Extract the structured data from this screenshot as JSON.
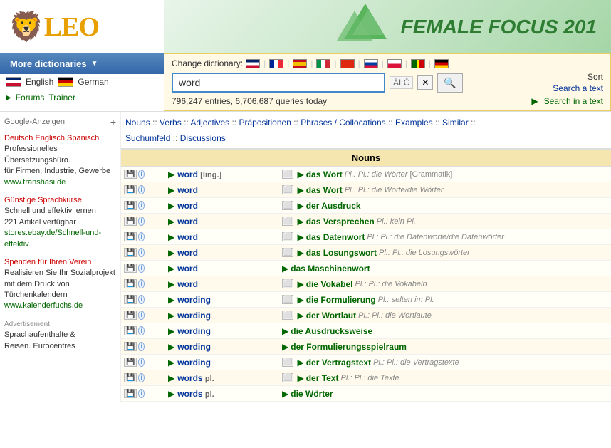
{
  "header": {
    "logo_text": "LEO",
    "banner_text": "FEMALE FOCUS 201",
    "more_dict_label": "More dictionaries",
    "lang1": "English",
    "lang2": "German",
    "forums_label": "Forums",
    "trainer_label": "Trainer"
  },
  "search": {
    "change_dict_label": "Change dictionary:",
    "input_value": "word",
    "options_label": "ÄLČ",
    "stats_text": "796,247 entries, 6,706,687 queries today",
    "search_in_text_label": "Search in a text",
    "sort_label": "Sort",
    "search_a_text_label": "Search a text"
  },
  "nav": {
    "items": [
      {
        "label": "Nouns",
        "sep": " :: "
      },
      {
        "label": "Verbs",
        "sep": " :: "
      },
      {
        "label": "Adjectives",
        "sep": " :: "
      },
      {
        "label": "Präpositionen",
        "sep": " :: "
      },
      {
        "label": "Phrases / Collocations",
        "sep": " :: "
      },
      {
        "label": "Examples",
        "sep": " :: "
      },
      {
        "label": "Similar",
        "sep": " :: "
      },
      {
        "label": "Suchumfeld",
        "sep": " :: "
      },
      {
        "label": "Discussions",
        "sep": ""
      }
    ]
  },
  "section_label": "Nouns",
  "results": [
    {
      "en": "word",
      "en_tag": "[ling.]",
      "de": "das Wort",
      "de_pl": "Pl.: die Wörter",
      "de_extra": "[Grammatik]",
      "has_copy": true
    },
    {
      "en": "word",
      "en_tag": "",
      "de": "das Wort",
      "de_pl": "Pl.: die Worte/die Wörter",
      "de_extra": "",
      "has_copy": true
    },
    {
      "en": "word",
      "en_tag": "",
      "de": "der Ausdruck",
      "de_pl": "",
      "de_extra": "",
      "has_copy": true
    },
    {
      "en": "word",
      "en_tag": "",
      "de": "das Versprechen",
      "de_pl": "kein Pl.",
      "de_extra": "",
      "has_copy": true
    },
    {
      "en": "word",
      "en_tag": "",
      "de": "das Datenwort",
      "de_pl": "Pl.: die Datenworte/die Datenwörter",
      "de_extra": "",
      "has_copy": true
    },
    {
      "en": "word",
      "en_tag": "",
      "de": "das Losungswort",
      "de_pl": "Pl.: die Losungswörter",
      "de_extra": "",
      "has_copy": true
    },
    {
      "en": "word",
      "en_tag": "",
      "de": "das Maschinenwort",
      "de_pl": "",
      "de_extra": "",
      "has_copy": false
    },
    {
      "en": "word",
      "en_tag": "",
      "de": "die Vokabel",
      "de_pl": "Pl.: die Vokabeln",
      "de_extra": "",
      "has_copy": true
    },
    {
      "en": "wording",
      "en_tag": "",
      "de": "die Formulierung",
      "de_pl": "selten im Pl.",
      "de_extra": "",
      "has_copy": true
    },
    {
      "en": "wording",
      "en_tag": "",
      "de": "der Wortlaut",
      "de_pl": "Pl.: die Wortlaute",
      "de_extra": "",
      "has_copy": true
    },
    {
      "en": "wording",
      "en_tag": "",
      "de": "die Ausdrucksweise",
      "de_pl": "",
      "de_extra": "",
      "has_copy": false
    },
    {
      "en": "wording",
      "en_tag": "",
      "de": "der Formulierungsspielraum",
      "de_pl": "",
      "de_extra": "",
      "has_copy": false
    },
    {
      "en": "wording",
      "en_tag": "",
      "de": "der Vertragstext",
      "de_pl": "Pl.: die Vertragstexte",
      "de_extra": "",
      "has_copy": true
    },
    {
      "en": "words",
      "en_tag": "pl.",
      "de": "der Text",
      "de_pl": "Pl.: die Texte",
      "de_extra": "",
      "has_copy": true
    },
    {
      "en": "words",
      "en_tag": "pl.",
      "de": "die Wörter",
      "de_pl": "",
      "de_extra": "",
      "has_copy": false
    }
  ],
  "sidebar": {
    "google_label": "Google-Anzeigen",
    "ads": [
      {
        "title": "Deutsch Englisch Spanisch",
        "link_text": "Deutsch Englisch Spanisch",
        "desc": "Professionelles Übersetzungsbüro. für Firmen, Industrie, Gewerbe",
        "url": "www.transhasi.de"
      },
      {
        "title": "Günstige Sprachkurse",
        "link_text": "Günstige Sprachkurse",
        "desc": "Schnell und effektiv lernen 221 Artikel verfügbar",
        "url": "stores.ebay.de/Schnell-und-effektiv"
      },
      {
        "title": "Spenden für Ihren Verein",
        "link_text": "Spenden für Ihren Verein",
        "desc": "Realisieren Sie Ihr Sozialprojekt mit dem Druck von Türchenkalendern",
        "url": "www.kalenderfuchs.de"
      },
      {
        "label": "Advertisement",
        "text": "Sprachaufenthalte & Reisen. Eurocentres",
        "url": ""
      }
    ]
  }
}
